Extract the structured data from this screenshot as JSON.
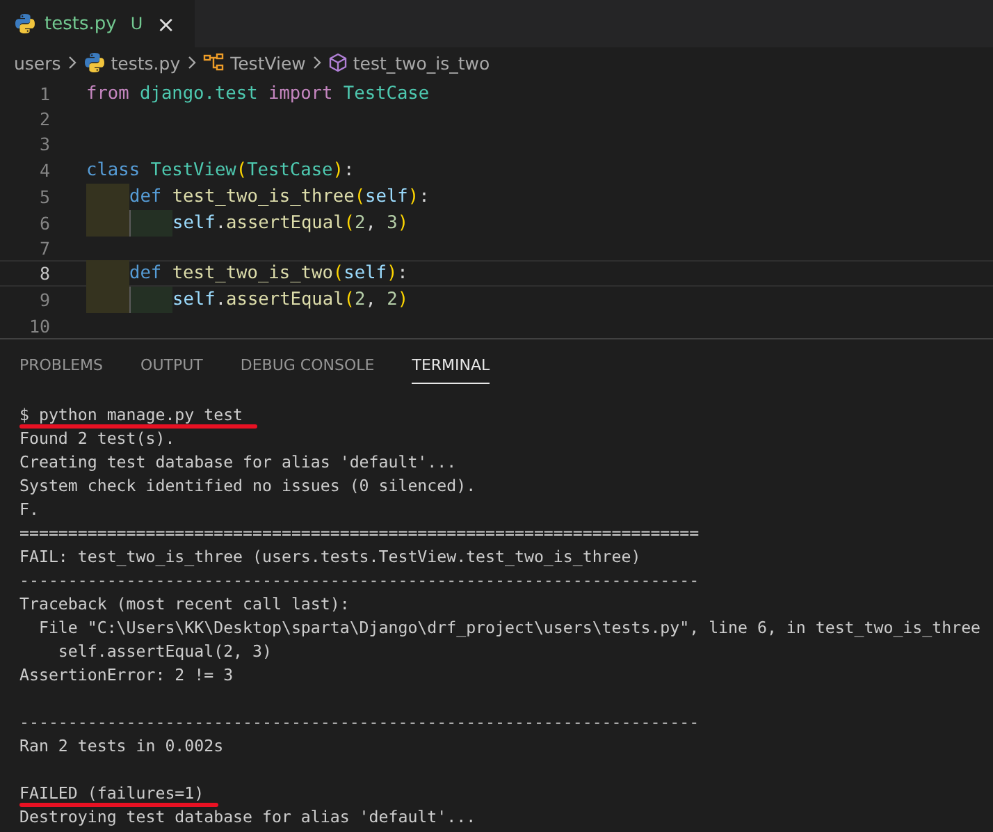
{
  "tab": {
    "label": "tests.py",
    "badge": "U",
    "close": "×",
    "selected": true
  },
  "breadcrumbs": [
    {
      "kind": "folder",
      "label": "users"
    },
    {
      "kind": "python",
      "label": "tests.py"
    },
    {
      "kind": "class",
      "label": "TestView"
    },
    {
      "kind": "method",
      "label": "test_two_is_two"
    }
  ],
  "editor": {
    "lines": [
      {
        "number": "1",
        "current": false,
        "tokens": [
          {
            "kind": "keyword",
            "text": "from "
          },
          {
            "kind": "module",
            "text": "django.test "
          },
          {
            "kind": "keyword",
            "text": "import "
          },
          {
            "kind": "class",
            "text": "TestCase"
          }
        ]
      },
      {
        "number": "2",
        "current": false
      },
      {
        "number": "3",
        "current": false
      },
      {
        "number": "4",
        "current": false,
        "tokens": [
          {
            "kind": "def",
            "text": "class "
          },
          {
            "kind": "class",
            "text": "TestView"
          },
          {
            "kind": "paren",
            "text": "("
          },
          {
            "kind": "class",
            "text": "TestCase"
          },
          {
            "kind": "paren",
            "text": ")"
          },
          {
            "kind": "plain",
            "text": ":"
          }
        ],
        "children": [
          {
            "number": "5",
            "current": false,
            "tokens": [
              {
                "kind": "def",
                "text": "def "
              },
              {
                "kind": "function",
                "text": "test_two_is_three"
              },
              {
                "kind": "paren",
                "text": "("
              },
              {
                "kind": "self",
                "text": "self"
              },
              {
                "kind": "paren",
                "text": ")"
              },
              {
                "kind": "plain",
                "text": ":"
              }
            ],
            "children": [
              {
                "number": "6",
                "current": false,
                "tokens": [
                  {
                    "kind": "self",
                    "text": "self"
                  },
                  {
                    "kind": "plain",
                    "text": "."
                  },
                  {
                    "kind": "function",
                    "text": "assertEqual"
                  },
                  {
                    "kind": "paren",
                    "text": "("
                  },
                  {
                    "kind": "number",
                    "text": "2"
                  },
                  {
                    "kind": "plain",
                    "text": ", "
                  },
                  {
                    "kind": "number",
                    "text": "3"
                  },
                  {
                    "kind": "paren",
                    "text": ")"
                  }
                ]
              }
            ]
          },
          {
            "number": "7",
            "current": false
          },
          {
            "number": "8",
            "current": true,
            "tokens": [
              {
                "kind": "def",
                "text": "def "
              },
              {
                "kind": "function",
                "text": "test_two_is_two"
              },
              {
                "kind": "paren",
                "text": "("
              },
              {
                "kind": "self",
                "text": "self"
              },
              {
                "kind": "paren",
                "text": ")"
              },
              {
                "kind": "plain",
                "text": ":"
              }
            ],
            "children": [
              {
                "number": "9",
                "current": false,
                "tokens": [
                  {
                    "kind": "self",
                    "text": "self"
                  },
                  {
                    "kind": "plain",
                    "text": "."
                  },
                  {
                    "kind": "function",
                    "text": "assertEqual"
                  },
                  {
                    "kind": "paren",
                    "text": "("
                  },
                  {
                    "kind": "number",
                    "text": "2"
                  },
                  {
                    "kind": "plain",
                    "text": ", "
                  },
                  {
                    "kind": "number",
                    "text": "2"
                  },
                  {
                    "kind": "paren",
                    "text": ")"
                  }
                ]
              }
            ]
          }
        ]
      },
      {
        "number": "10",
        "current": false
      }
    ]
  },
  "panel_tabs": [
    {
      "label": "PROBLEMS",
      "selected": false
    },
    {
      "label": "OUTPUT",
      "selected": false
    },
    {
      "label": "DEBUG CONSOLE",
      "selected": false
    },
    {
      "label": "TERMINAL",
      "selected": true
    }
  ],
  "terminal": {
    "blocks": [
      {
        "lines": [
          {
            "text": "$ python manage.py test",
            "underlined": true
          },
          {
            "text": "Found 2 test(s).",
            "underlined": false
          },
          {
            "text": "Creating test database for alias 'default'...",
            "underlined": false
          },
          {
            "text": "System check identified no issues (0 silenced).",
            "underlined": false
          },
          {
            "text": "F.",
            "underlined": false
          },
          {
            "text": "======================================================================",
            "underlined": false
          },
          {
            "text": "FAIL: test_two_is_three (users.tests.TestView.test_two_is_three)",
            "underlined": false
          },
          {
            "text": "----------------------------------------------------------------------",
            "underlined": false
          },
          {
            "text": "Traceback (most recent call last):",
            "underlined": false
          },
          {
            "text": "  File \"C:\\Users\\KK\\Desktop\\sparta\\Django\\drf_project\\users\\tests.py\", line 6, in test_two_is_three",
            "underlined": false
          },
          {
            "text": "    self.assertEqual(2, 3)",
            "underlined": false
          },
          {
            "text": "AssertionError: 2 != 3",
            "underlined": false
          }
        ]
      },
      {
        "lines": [
          {
            "text": "----------------------------------------------------------------------",
            "underlined": false
          },
          {
            "text": "Ran 2 tests in 0.002s",
            "underlined": false
          }
        ]
      },
      {
        "lines": [
          {
            "text": "FAILED (failures=1)",
            "underlined": true
          },
          {
            "text": "Destroying test database for alias 'default'...",
            "underlined": false
          }
        ]
      }
    ]
  }
}
